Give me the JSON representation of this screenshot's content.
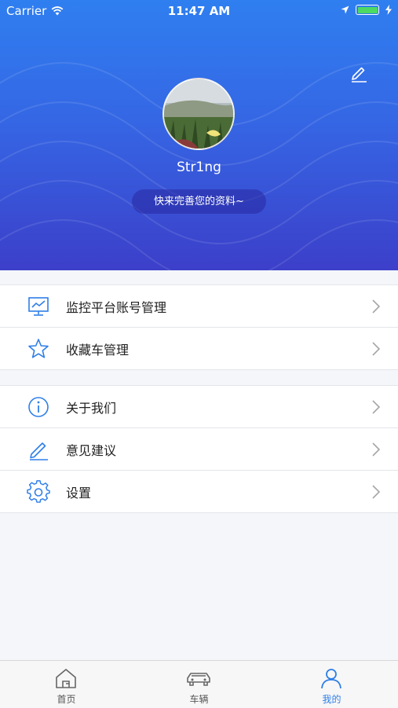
{
  "status_bar": {
    "carrier": "Carrier",
    "time": "11:47 AM",
    "battery_level": 1.0
  },
  "profile": {
    "username": "Str1ng",
    "complete_profile_label": "快来完善您的资料~"
  },
  "menu": {
    "group1": [
      {
        "label": "监控平台账号管理",
        "icon": "monitor-chart-icon"
      },
      {
        "label": "收藏车管理",
        "icon": "star-icon"
      }
    ],
    "group2": [
      {
        "label": "关于我们",
        "icon": "info-icon"
      },
      {
        "label": "意见建议",
        "icon": "pen-icon"
      },
      {
        "label": "设置",
        "icon": "gear-icon"
      }
    ]
  },
  "tabbar": {
    "tabs": [
      {
        "label": "首页",
        "icon": "home-icon",
        "active": false
      },
      {
        "label": "车辆",
        "icon": "car-icon",
        "active": false
      },
      {
        "label": "我的",
        "icon": "person-icon",
        "active": true
      }
    ]
  },
  "colors": {
    "accent": "#2f7fe8",
    "header_top": "#2f7ff0",
    "header_bottom": "#3c3fc9"
  }
}
